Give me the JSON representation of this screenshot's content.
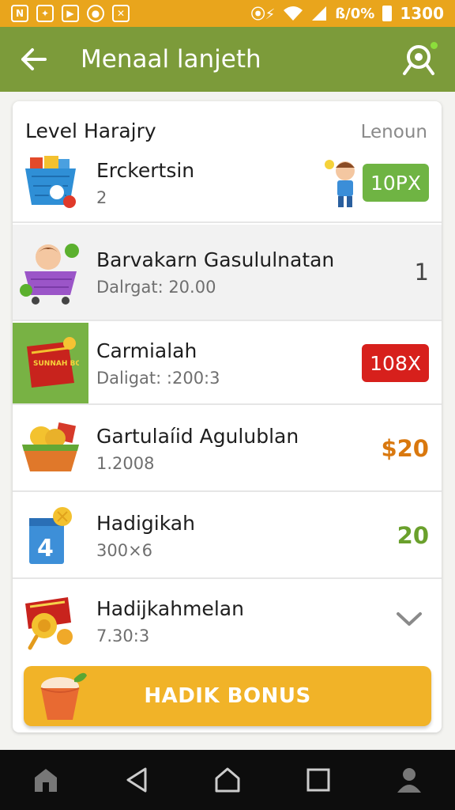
{
  "status_bar": {
    "icons": [
      "nfc-icon",
      "chat-icon",
      "play-icon",
      "record-icon",
      "photo-icon"
    ],
    "right_glyphs": "⦿⚡",
    "battery_text": "ß/0%",
    "time": "1300"
  },
  "app_bar": {
    "title": "Menaal lanjeth",
    "back_icon": "arrow-back-icon",
    "search_icon": "search-icon"
  },
  "card": {
    "title": "Level Harajry",
    "link": "Lenoun",
    "rows": [
      {
        "title": "Erckertsin",
        "subtitle": "2",
        "value": "10PX",
        "value_style": "green-badge",
        "icon": "shopping-basket-icon"
      },
      {
        "title": "Barvakarn Gasululnatan",
        "subtitle": "Dalrgat: 20.00",
        "value": "1",
        "value_style": "plain",
        "icon": "shopping-cart-icon"
      },
      {
        "title": "Carmialah",
        "subtitle": "Daligat: :200:3",
        "value": "108X",
        "value_style": "red-badge",
        "icon": "gift-box-icon"
      },
      {
        "title": "Gartulaíid Agulublan",
        "subtitle": "1.2008",
        "value": "$20",
        "value_style": "orange",
        "icon": "fruit-basket-icon"
      },
      {
        "title": "Hadigikah",
        "subtitle": "300×6",
        "value": "20",
        "value_style": "green",
        "icon": "calendar-icon"
      },
      {
        "title": "Hadijkahmelan",
        "subtitle": "7.30:3",
        "value": "",
        "value_style": "chevron",
        "icon": "ticket-icon"
      }
    ],
    "bonus_button": "HADIK BONUS",
    "bonus_icon": "cup-icon",
    "box_text": "SUNNAH BOX"
  },
  "nav_bar": {
    "icons": [
      "home-icon",
      "back-triangle-icon",
      "home-circle-icon",
      "recents-square-icon",
      "person-icon"
    ]
  },
  "colors": {
    "status": "#e9a51c",
    "app_bar": "#7c9b3a",
    "accent_green": "#6fb443",
    "accent_red": "#d7201c",
    "accent_orange": "#d9780e",
    "bonus": "#f1b328"
  }
}
